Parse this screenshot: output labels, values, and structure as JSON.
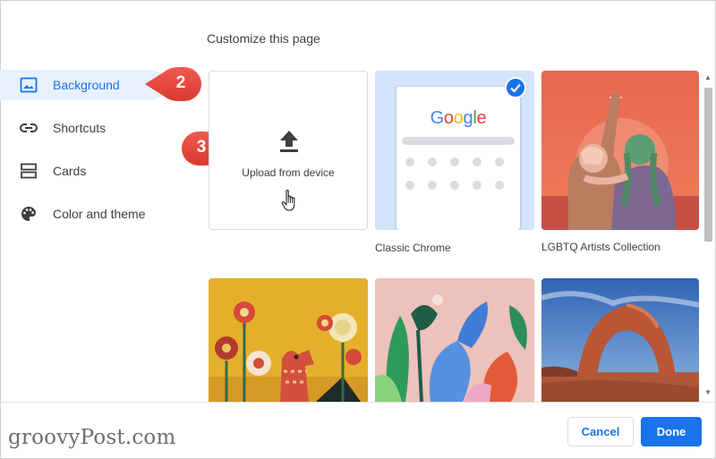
{
  "page_title": "Customize this page",
  "sidebar": {
    "items": [
      {
        "label": "Background",
        "icon": "image-icon",
        "active": true
      },
      {
        "label": "Shortcuts",
        "icon": "link-icon",
        "active": false
      },
      {
        "label": "Cards",
        "icon": "cards-icon",
        "active": false
      },
      {
        "label": "Color and theme",
        "icon": "palette-icon",
        "active": false
      }
    ]
  },
  "callouts": [
    {
      "number": "2",
      "color": "#e8453c"
    },
    {
      "number": "3",
      "color": "#e8453c"
    }
  ],
  "tiles": {
    "upload": {
      "label": "Upload from device",
      "icon": "upload-icon"
    },
    "classic_chrome": {
      "caption": "Classic Chrome",
      "logo_text": "Google",
      "selected": true
    },
    "lgbtq": {
      "caption": "LGBTQ Artists Collection"
    }
  },
  "footer": {
    "cancel_label": "Cancel",
    "done_label": "Done"
  },
  "watermark": "groovyPost.com",
  "colors": {
    "accent": "#1a73e8",
    "active_bg": "#e8f0fe",
    "selected_tile_bg": "#d2e3fc",
    "callout": "#e8453c"
  }
}
